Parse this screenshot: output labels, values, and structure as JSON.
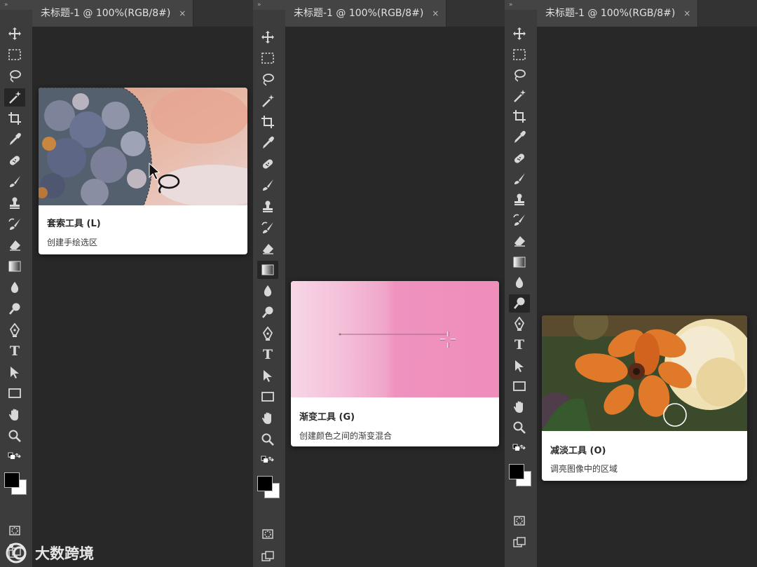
{
  "panels": [
    {
      "tab_title": "未标题-1 @ 100%(RGB/8#)",
      "tab_close": "×",
      "active_tool": "magic-wand",
      "tooltip": {
        "title": "套索工具 (L)",
        "description": "创建手绘选区"
      }
    },
    {
      "tab_title": "未标题-1 @ 100%(RGB/8#)",
      "tab_close": "×",
      "active_tool": "gradient",
      "tooltip": {
        "title": "渐变工具 (G)",
        "description": "创建颜色之间的渐变混合"
      }
    },
    {
      "tab_title": "未标题-1 @ 100%(RGB/8#)",
      "tab_close": "×",
      "active_tool": "dodge",
      "tooltip": {
        "title": "减淡工具 (O)",
        "description": "调亮图像中的区域"
      }
    }
  ],
  "toolbar_grip": "»",
  "tools": [
    "move",
    "marquee",
    "lasso",
    "magic-wand",
    "crop",
    "eyedropper",
    "healing",
    "brush",
    "stamp",
    "history-brush",
    "eraser",
    "gradient",
    "blur",
    "dodge",
    "pen",
    "type",
    "path-select",
    "rectangle",
    "hand",
    "zoom",
    "more",
    "swap-colors",
    "color-swatches",
    "quick-mask",
    "screen-mode"
  ],
  "tool_text": {
    "type": "T",
    "more": "•••"
  },
  "watermark": "大数跨境",
  "colors": {
    "toolbar": "#3c3c3c",
    "canvas": "#282828",
    "tab": "#444444",
    "gradient_start": "#f6d3e6",
    "gradient_end": "#ef8dbb"
  }
}
